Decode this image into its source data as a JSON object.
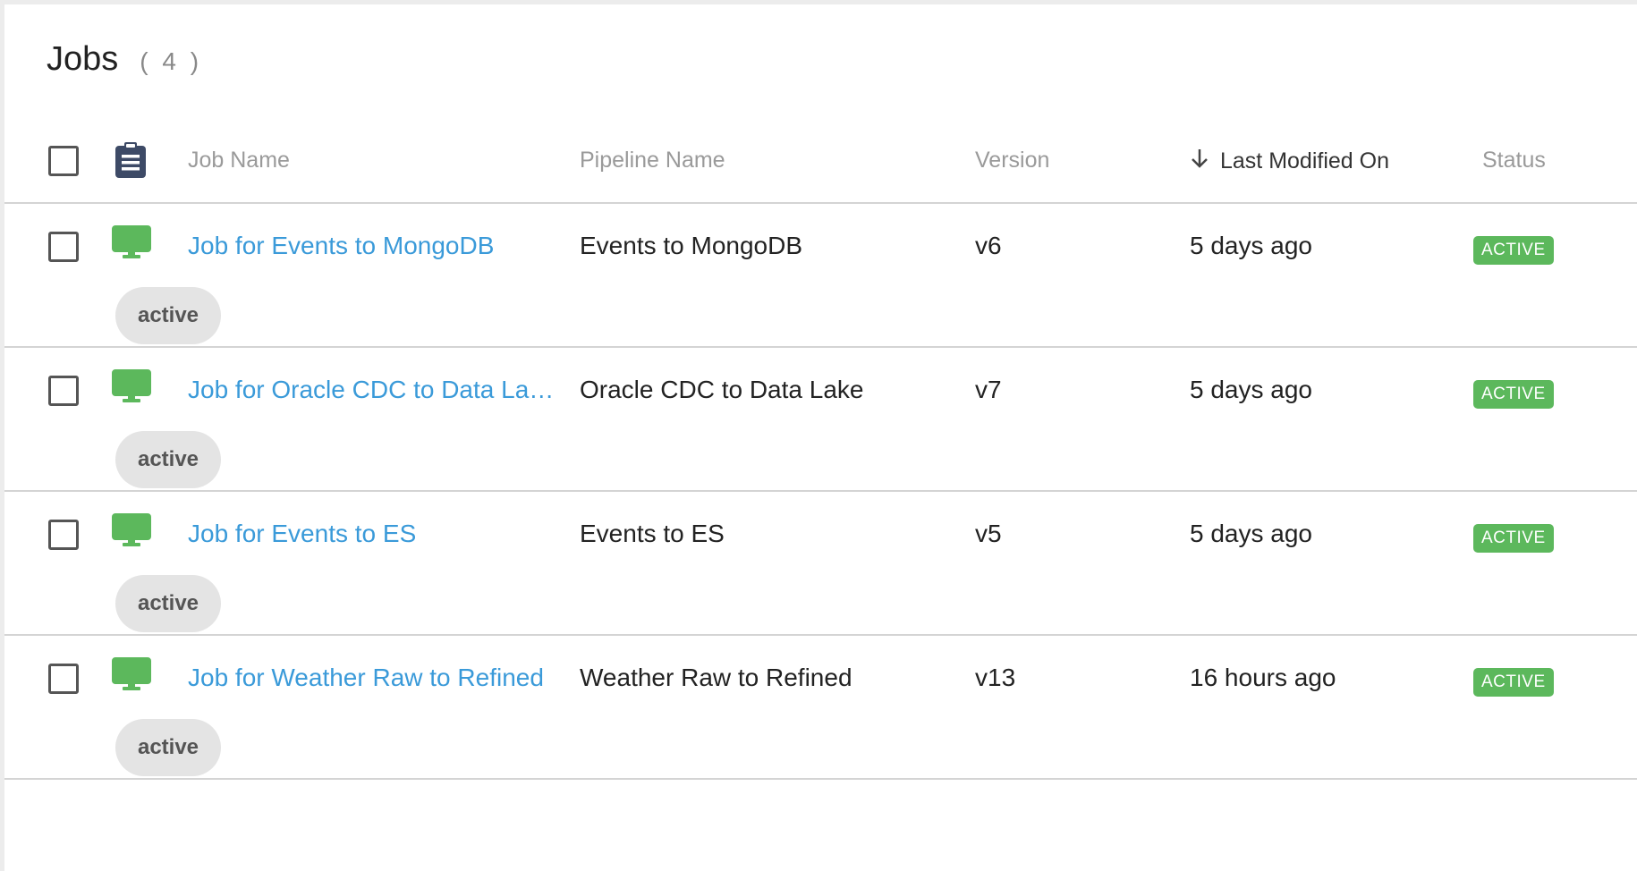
{
  "header": {
    "title": "Jobs",
    "count": "( 4 )"
  },
  "columns": {
    "job_name": "Job Name",
    "pipeline_name": "Pipeline Name",
    "version": "Version",
    "last_modified": "Last Modified On",
    "status": "Status"
  },
  "icons": {
    "header_icon": "clipboard-icon",
    "row_icon": "monitor-icon",
    "sort_icon": "arrow-down-icon"
  },
  "colors": {
    "link": "#3a9ad9",
    "active_green": "#5cb85c",
    "header_icon": "#3d4a66"
  },
  "rows": [
    {
      "job_name": "Job for Events to MongoDB",
      "pipeline_name": "Events to MongoDB",
      "version": "v6",
      "last_modified": "5 days ago",
      "status": "ACTIVE",
      "tag": "active"
    },
    {
      "job_name": "Job for Oracle CDC to Data La…",
      "pipeline_name": "Oracle CDC to Data Lake",
      "version": "v7",
      "last_modified": "5 days ago",
      "status": "ACTIVE",
      "tag": "active"
    },
    {
      "job_name": "Job for Events to ES",
      "pipeline_name": "Events to ES",
      "version": "v5",
      "last_modified": "5 days ago",
      "status": "ACTIVE",
      "tag": "active"
    },
    {
      "job_name": "Job for Weather Raw to Refined",
      "pipeline_name": "Weather Raw to Refined",
      "version": "v13",
      "last_modified": "16 hours ago",
      "status": "ACTIVE",
      "tag": "active"
    }
  ]
}
